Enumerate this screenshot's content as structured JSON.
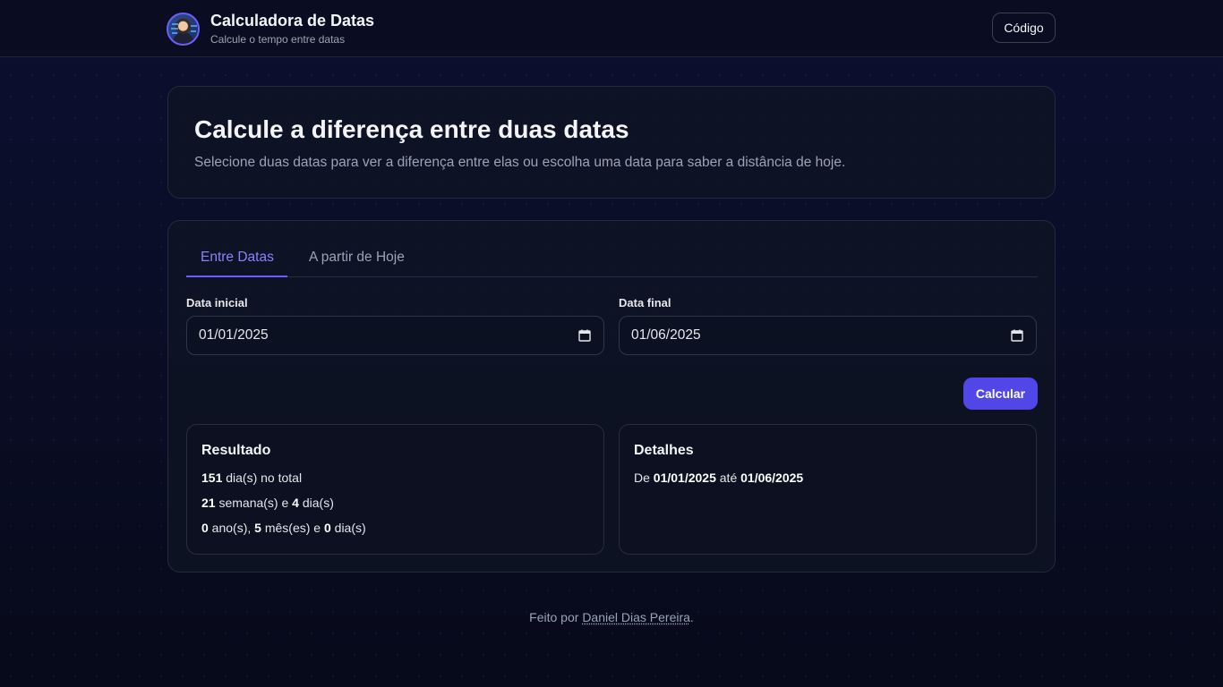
{
  "header": {
    "title": "Calculadora de Datas",
    "subtitle": "Calcule o tempo entre datas",
    "code_button": "Código"
  },
  "hero": {
    "title": "Calcule a diferença entre duas datas",
    "description": "Selecione duas datas para ver a diferença entre elas ou escolha uma data para saber a distância de hoje."
  },
  "tabs": [
    {
      "label": "Entre Datas",
      "active": true
    },
    {
      "label": "A partir de Hoje",
      "active": false
    }
  ],
  "form": {
    "start_label": "Data inicial",
    "start_value": "01/01/2025",
    "end_label": "Data final",
    "end_value": "01/06/2025",
    "calculate_label": "Calcular"
  },
  "result": {
    "title": "Resultado",
    "total_days": "151",
    "total_days_suffix": " dia(s) no total",
    "weeks": "21",
    "weeks_mid": " semana(s) e ",
    "weeks_days": "4",
    "weeks_suffix": " dia(s)",
    "years": "0",
    "years_mid": " ano(s), ",
    "months": "5",
    "months_mid": " mês(es) e ",
    "days": "0",
    "days_suffix": " dia(s)"
  },
  "details": {
    "title": "Detalhes",
    "prefix": "De ",
    "from": "01/01/2025",
    "mid": " até ",
    "to": "01/06/2025"
  },
  "footer": {
    "prefix": "Feito por ",
    "author": "Daniel Dias Pereira",
    "suffix": "."
  },
  "colors": {
    "accent": "#6d5dfc",
    "button": "#5147e8",
    "background": "#0a0d26"
  }
}
